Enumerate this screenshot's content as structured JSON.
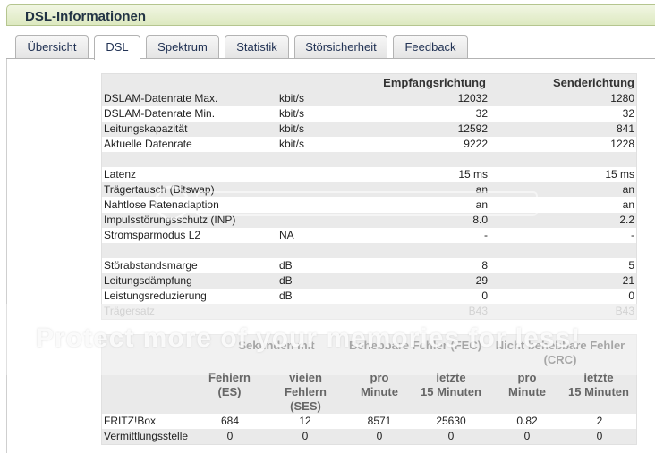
{
  "title": "DSL-Informationen",
  "tabs": [
    "Übersicht",
    "DSL",
    "Spektrum",
    "Statistik",
    "Störsicherheit",
    "Feedback"
  ],
  "active_tab": "DSL",
  "table1": {
    "headers": [
      "",
      "",
      "Empfangsrichtung",
      "Senderichtung"
    ],
    "rows": [
      [
        "DSLAM-Datenrate Max.",
        "kbit/s",
        "12032",
        "1280"
      ],
      [
        "DSLAM-Datenrate Min.",
        "kbit/s",
        "32",
        "32"
      ],
      [
        "Leitungskapazität",
        "kbit/s",
        "12592",
        "841"
      ],
      [
        "Aktuelle Datenrate",
        "kbit/s",
        "9222",
        "1228"
      ],
      [
        "",
        "",
        "",
        ""
      ],
      [
        "Latenz",
        "",
        "15 ms",
        "15 ms"
      ],
      [
        "Trägertausch (Bitswap)",
        "",
        "an",
        "an"
      ],
      [
        "Nahtlose Ratenadaption",
        "",
        "an",
        "an"
      ],
      [
        "Impulsstörungsschutz (INP)",
        "",
        "8.0",
        "2.2"
      ],
      [
        "Stromsparmodus L2",
        "NA",
        "-",
        "-"
      ],
      [
        "",
        "",
        "",
        ""
      ],
      [
        "Störabstandsmarge",
        "dB",
        "8",
        "5"
      ],
      [
        "Leitungsdämpfung",
        "dB",
        "29",
        "21"
      ],
      [
        "Leistungsreduzierung",
        "dB",
        "0",
        "0"
      ],
      [
        "Trägersatz",
        "",
        "B43",
        "B43"
      ]
    ]
  },
  "table2": {
    "group_headers": [
      "Sekunden mit",
      "Behebbare Fehler (FEC)",
      "Nicht behebbare Fehler (CRC)"
    ],
    "sub_headers": [
      "Fehlern (ES)",
      "vielen Fehlern (SES)",
      "pro Minute",
      "letzte 15 Minuten",
      "pro Minute",
      "letzte 15 Minuten"
    ],
    "sub_headers_lines": [
      [
        "Fehlern",
        "(ES)"
      ],
      [
        "vielen",
        "Fehlern",
        "(SES)"
      ],
      [
        "pro",
        "Minute"
      ],
      [
        "letzte",
        "15 Minuten"
      ],
      [
        "pro",
        "Minute"
      ],
      [
        "letzte",
        "15 Minuten"
      ]
    ],
    "rows": [
      [
        "FRITZ!Box",
        "684",
        "12",
        "8571",
        "25630",
        "0.82",
        "2"
      ],
      [
        "Vermittlungsstelle",
        "0",
        "0",
        "0",
        "0",
        "0",
        "0"
      ]
    ]
  },
  "watermark_text": "Protect more of your memories for less!"
}
